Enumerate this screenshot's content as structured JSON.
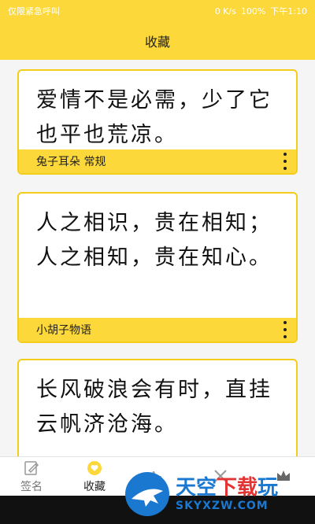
{
  "status": {
    "left": "仅限紧急呼叫",
    "speed": "0 K/s",
    "battery": "100%",
    "time": "下午1:10"
  },
  "title": "收藏",
  "cards": [
    {
      "text": "爱情不是必需，少了它也平也荒凉。",
      "font": "兔子耳朵 常规"
    },
    {
      "text": "人之相识，贵在相知；人之相知，贵在知心。",
      "font": "小胡子物语"
    },
    {
      "text": "长风破浪会有时，直挂云帆济沧海。",
      "font": ""
    }
  ],
  "tabs": [
    {
      "label": "签名",
      "icon": "edit-icon"
    },
    {
      "label": "收藏",
      "icon": "heart-icon"
    },
    {
      "label": "",
      "icon": "font-icon"
    },
    {
      "label": "",
      "icon": "tools-icon"
    },
    {
      "label": "",
      "icon": "crown-icon"
    }
  ],
  "watermark": {
    "brand_blue": "天空",
    "brand_red": "下载",
    "brand_blue2": "玩",
    "domain": "SKYXZW.COM"
  },
  "colors": {
    "accent": "#fcd83a",
    "border": "#f4cc1a",
    "watermark_blue": "#1a78d1",
    "watermark_red": "#e33434"
  }
}
